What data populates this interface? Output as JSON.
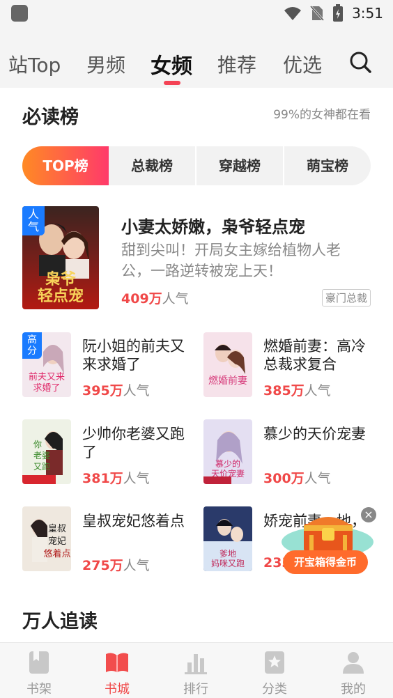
{
  "status_bar": {
    "time": "3:51"
  },
  "tabs": [
    {
      "label": "站Top"
    },
    {
      "label": "男频"
    },
    {
      "label": "女频",
      "active": true
    },
    {
      "label": "推荐"
    },
    {
      "label": "优选"
    }
  ],
  "section1": {
    "title": "必读榜",
    "subtitle": "99%的女神都在看"
  },
  "chips": [
    "TOP榜",
    "总裁榜",
    "穿越榜",
    "萌宝榜"
  ],
  "hero": {
    "badge": "人气",
    "title": "小妻太娇嫩，枭爷轻点宠",
    "desc": "甜到尖叫！开局女主嫁给植物人老公，一路逆转被宠上天！",
    "popularity_num": "409万",
    "popularity_unit": "人气",
    "tag": "豪门总裁"
  },
  "items": [
    {
      "title": "阮小姐的前夫又来求婚了",
      "num": "395万",
      "unit": "人气",
      "badge": "高分"
    },
    {
      "title": "燃婚前妻：高冷总裁求复合",
      "num": "385万",
      "unit": "人气"
    },
    {
      "title": "少帅你老婆又跑了",
      "num": "381万",
      "unit": "人气"
    },
    {
      "title": "慕少的天价宠妻",
      "num": "300万",
      "unit": "人气"
    },
    {
      "title": "皇叔宠妃悠着点",
      "num": "275万",
      "unit": "人气"
    },
    {
      "title": "娇宠前妻，地，",
      "num": "233",
      "unit": ""
    }
  ],
  "section2": {
    "title": "万人追读"
  },
  "treasure": {
    "label": "开宝箱得金币"
  },
  "bottom_nav": [
    {
      "label": "书架",
      "icon": "bookshelf-icon"
    },
    {
      "label": "书城",
      "icon": "bookstore-icon",
      "active": true
    },
    {
      "label": "排行",
      "icon": "ranking-icon"
    },
    {
      "label": "分类",
      "icon": "category-icon"
    },
    {
      "label": "我的",
      "icon": "profile-icon"
    }
  ],
  "colors": {
    "accent": "#f04848",
    "tab_indicator": "#f44355",
    "chip_gradient_start": "#ff8a24",
    "chip_gradient_end": "#ff3a6a",
    "badge_blue": "#1a7bff"
  }
}
